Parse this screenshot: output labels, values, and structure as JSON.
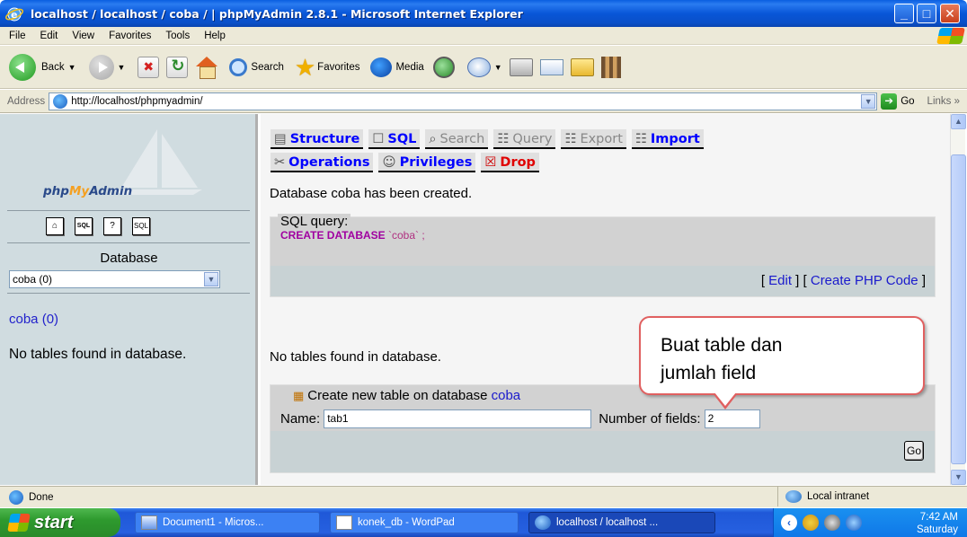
{
  "window": {
    "title": "localhost / localhost / coba / | phpMyAdmin 2.8.1 - Microsoft Internet Explorer",
    "minimize": "_",
    "maximize": "□",
    "close": "✕"
  },
  "menu": [
    "File",
    "Edit",
    "View",
    "Favorites",
    "Tools",
    "Help"
  ],
  "toolbar": {
    "back": "Back",
    "search": "Search",
    "favorites": "Favorites",
    "media": "Media"
  },
  "address": {
    "label": "Address",
    "url": "http://localhost/phpmyadmin/",
    "go": "Go",
    "links": "Links"
  },
  "left": {
    "logo_php": "php",
    "logo_my": "My",
    "logo_admin": "Admin",
    "quick_icons": [
      "home-icon",
      "sql-icon",
      "help-icon",
      "query-window-icon"
    ],
    "database_label": "Database",
    "database_selected": "coba (0)",
    "db_link": "coba (0)",
    "no_tables": "No tables found in database."
  },
  "tabs": [
    {
      "label": "Structure",
      "icon": "structure-icon",
      "glyph": "▤"
    },
    {
      "label": "SQL",
      "icon": "sql-icon",
      "glyph": "☐"
    },
    {
      "label": "Search",
      "icon": "search-icon",
      "glyph": "⌕"
    },
    {
      "label": "Query",
      "icon": "query-icon",
      "glyph": "☷"
    },
    {
      "label": "Export",
      "icon": "export-icon",
      "glyph": "☷"
    },
    {
      "label": "Import",
      "icon": "import-icon",
      "glyph": "☷"
    },
    {
      "label": "Operations",
      "icon": "operations-icon",
      "glyph": "✂"
    },
    {
      "label": "Privileges",
      "icon": "privileges-icon",
      "glyph": "☺"
    },
    {
      "label": "Drop",
      "icon": "drop-icon",
      "glyph": "☒"
    }
  ],
  "main": {
    "created_message": "Database coba has been created.",
    "sql_legend": "SQL query:",
    "sql_keyword": "CREATE DATABASE",
    "sql_name": " `coba` ;",
    "edit_link": "Edit",
    "create_php_link": "Create PHP Code",
    "no_tables": "No tables found in database.",
    "create_legend": "Create new table on database",
    "create_db": "coba",
    "name_label": "Name:",
    "name_value": "tab1",
    "fields_label": "Number of fields:",
    "fields_value": "2",
    "go": "Go"
  },
  "callout": {
    "line1": "Buat table dan",
    "line2": "jumlah field"
  },
  "status": {
    "text": "Done",
    "zone": "Local intranet"
  },
  "taskbar": {
    "start": "start",
    "tasks": [
      "Document1 - Micros...",
      "konek_db - WordPad",
      "localhost / localhost ..."
    ],
    "time": "7:42 AM",
    "day": "Saturday"
  }
}
